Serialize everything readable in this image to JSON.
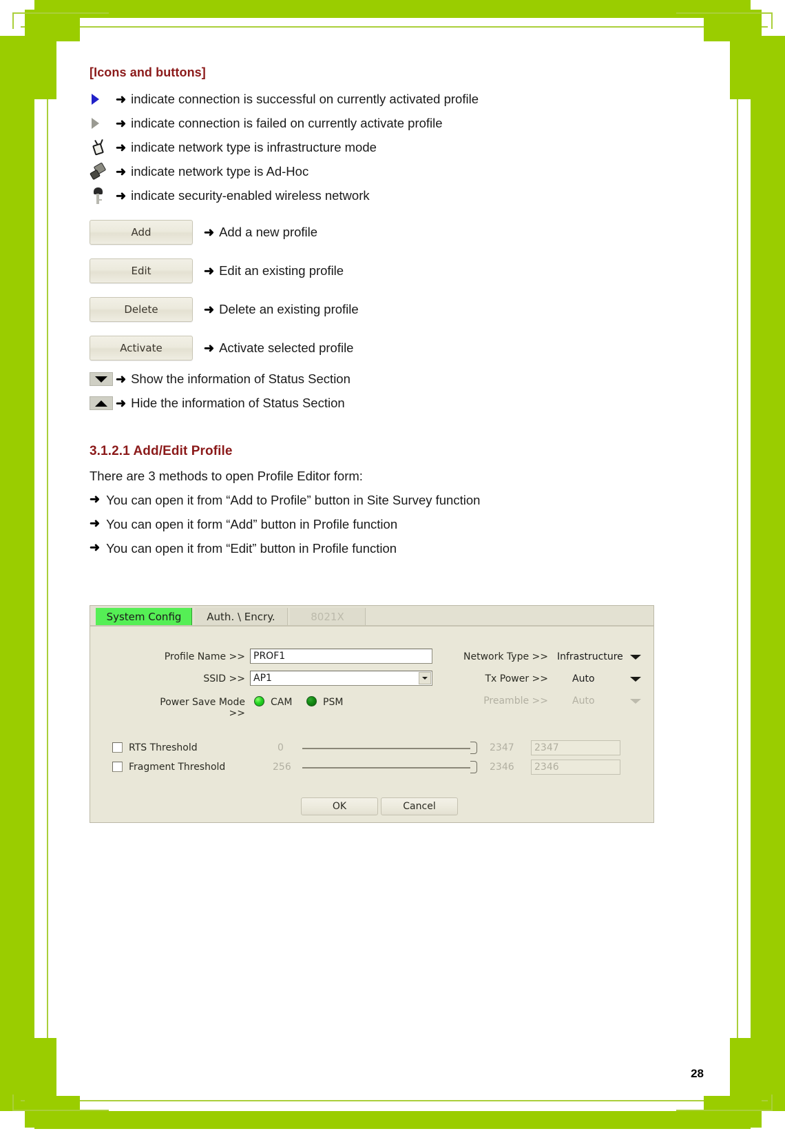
{
  "frame": {
    "accent_color": "#9acd00",
    "rule_color": "#aacf3a"
  },
  "section": {
    "heading": "[Icons and buttons]",
    "icon_rows": [
      {
        "icon": "play-triangle-blue-icon",
        "arrow": "➜",
        "text": "indicate connection is successful on currently activated profile"
      },
      {
        "icon": "play-triangle-gray-icon",
        "arrow": "➜",
        "text": "indicate connection is failed on currently activate profile"
      },
      {
        "icon": "access-point-icon",
        "arrow": "➜",
        "text": "indicate network type is infrastructure mode"
      },
      {
        "icon": "ad-hoc-devices-icon",
        "arrow": "➜",
        "text": "indicate network type is Ad-Hoc"
      },
      {
        "icon": "key-lock-icon",
        "arrow": "➜",
        "text": "indicate security-enabled wireless network"
      }
    ],
    "button_rows": [
      {
        "button_label": "Add",
        "arrow": "➜",
        "text": "Add a new profile"
      },
      {
        "button_label": "Edit",
        "arrow": "➜",
        "text": "Edit an existing profile"
      },
      {
        "button_label": "Delete",
        "arrow": "➜",
        "text": "Delete an existing profile"
      },
      {
        "button_label": "Activate",
        "arrow": "➜",
        "text": "Activate selected profile"
      }
    ],
    "toggle_rows": [
      {
        "icon": "triangle-down-icon",
        "arrow": "➜",
        "text": "Show the information of Status Section"
      },
      {
        "icon": "triangle-up-icon",
        "arrow": "➜",
        "text": "Hide the information of Status Section"
      }
    ]
  },
  "subsection": {
    "heading": "3.1.2.1 Add/Edit Profile",
    "intro": "There are 3 methods to open Profile Editor form:",
    "bullets": [
      {
        "arrow": "➜",
        "text": "You can open it from “Add to Profile” button in Site Survey function"
      },
      {
        "arrow": "➜",
        "text": "You can open it form “Add” button in Profile function"
      },
      {
        "arrow": "➜",
        "text": "You can open it from “Edit” button in Profile function"
      }
    ]
  },
  "dialog": {
    "tabs": [
      {
        "label": "System Config",
        "state": "active"
      },
      {
        "label": "Auth. \\ Encry.",
        "state": "normal"
      },
      {
        "label": "8021X",
        "state": "disabled"
      }
    ],
    "fields": {
      "profile_name_label": "Profile Name >>",
      "profile_name_value": "PROF1",
      "ssid_label": "SSID >>",
      "ssid_value": "AP1",
      "power_save_label": "Power Save Mode >>",
      "power_save_cam": "CAM",
      "power_save_psm": "PSM",
      "network_type_label": "Network Type >>",
      "network_type_value": "Infrastructure",
      "tx_power_label": "Tx Power >>",
      "tx_power_value": "Auto",
      "preamble_label": "Preamble >>",
      "preamble_value": "Auto",
      "rts_label": "RTS Threshold",
      "rts_min": "0",
      "rts_max": "2347",
      "rts_value": "2347",
      "frag_label": "Fragment Threshold",
      "frag_min": "256",
      "frag_max": "2346",
      "frag_value": "2346"
    },
    "buttons": {
      "ok": "OK",
      "cancel": "Cancel"
    }
  },
  "page_number": "28"
}
